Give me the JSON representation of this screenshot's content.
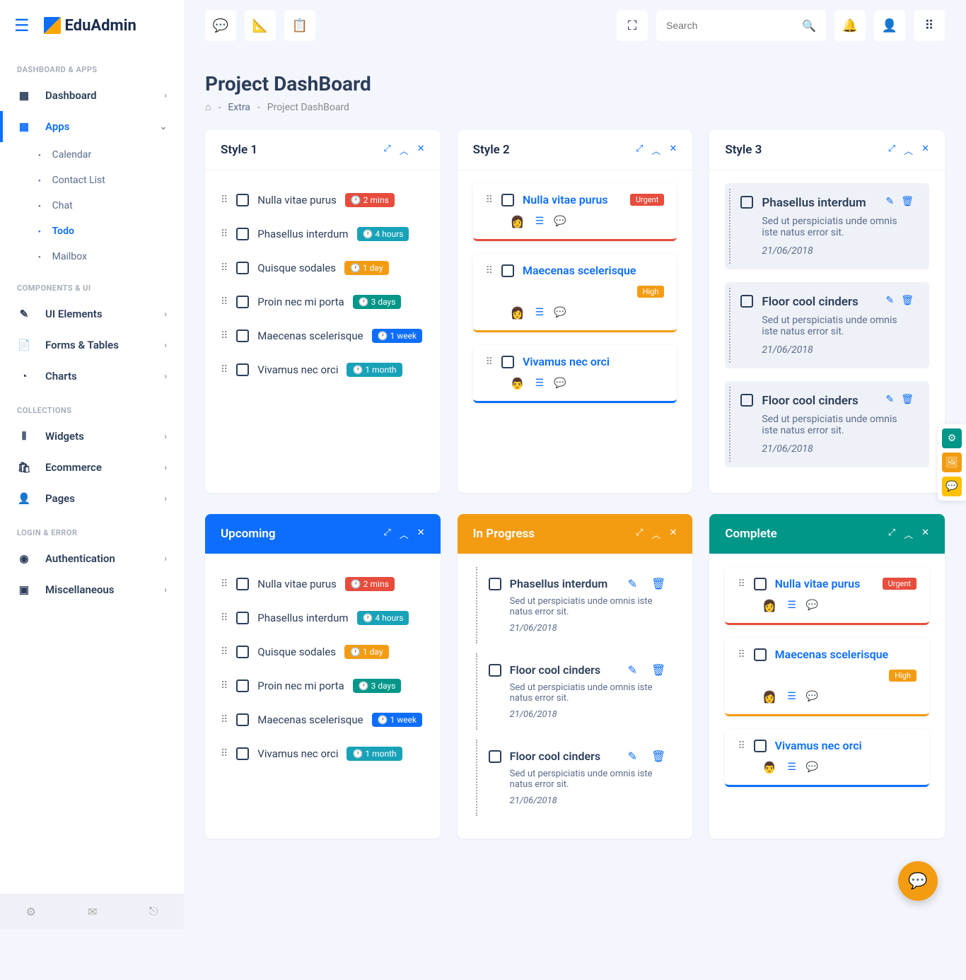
{
  "brand": "EduAdmin",
  "search": {
    "placeholder": "Search"
  },
  "sidebar": {
    "sections": {
      "s0": "DASHBOARD & APPS",
      "s1": "COMPONENTS & UI",
      "s2": "COLLECTIONS",
      "s3": "LOGIN & ERROR"
    },
    "items": {
      "dashboard": "Dashboard",
      "apps": "Apps",
      "ui": "UI Elements",
      "forms": "Forms & Tables",
      "charts": "Charts",
      "widgets": "Widgets",
      "ecommerce": "Ecommerce",
      "pages": "Pages",
      "auth": "Authentication",
      "misc": "Miscellaneous"
    },
    "subs": {
      "calendar": "Calendar",
      "contact": "Contact List",
      "chat": "Chat",
      "todo": "Todo",
      "mailbox": "Mailbox"
    }
  },
  "page": {
    "title": "Project DashBoard",
    "crumb_extra": "Extra",
    "crumb_current": "Project DashBoard"
  },
  "styles": {
    "s1": "Style 1",
    "s2": "Style 2",
    "s3": "Style 3",
    "upcoming": "Upcoming",
    "inProgress": "In Progress",
    "complete": "Complete"
  },
  "tasks1": [
    {
      "text": "Nulla vitae purus",
      "badge": "2 mins",
      "color": "red"
    },
    {
      "text": "Phasellus interdum",
      "badge": "4 hours",
      "color": "cyan"
    },
    {
      "text": "Quisque sodales",
      "badge": "1 day",
      "color": "orange"
    },
    {
      "text": "Proin nec mi porta",
      "badge": "3 days",
      "color": "green"
    },
    {
      "text": "Maecenas scelerisque",
      "badge": "1 week",
      "color": "blue"
    },
    {
      "text": "Vivamus nec orci",
      "badge": "1 month",
      "color": "cyan"
    }
  ],
  "tasks2": [
    {
      "text": "Nulla vitae purus",
      "pill": "Urgent",
      "pcolor": "red",
      "border": "u-red",
      "avatar": "👩"
    },
    {
      "text": "Maecenas scelerisque",
      "pill": "High",
      "pcolor": "orange",
      "border": "u-orange",
      "avatar": "👩"
    },
    {
      "text": "Vivamus nec orci",
      "pill": "",
      "pcolor": "",
      "border": "u-blue",
      "avatar": "👨"
    }
  ],
  "tasks3": [
    {
      "title": "Phasellus interdum",
      "desc": "Sed ut perspiciatis unde omnis iste natus error sit.",
      "date": "21/06/2018"
    },
    {
      "title": "Floor cool cinders",
      "desc": "Sed ut perspiciatis unde omnis iste natus error sit.",
      "date": "21/06/2018"
    },
    {
      "title": "Floor cool cinders",
      "desc": "Sed ut perspiciatis unde omnis iste natus error sit.",
      "date": "21/06/2018"
    }
  ],
  "inProgress": [
    {
      "title": "Phasellus interdum",
      "desc": "Sed ut perspiciatis unde omnis iste natus error sit.",
      "date": "21/06/2018"
    },
    {
      "title": "Floor cool cinders",
      "desc": "Sed ut perspiciatis unde omnis iste natus error sit.",
      "date": "21/06/2018"
    },
    {
      "title": "Floor cool cinders",
      "desc": "Sed ut perspiciatis unde omnis iste natus error sit.",
      "date": "21/06/2018"
    }
  ],
  "complete": [
    {
      "text": "Nulla vitae purus",
      "pill": "Urgent",
      "pcolor": "red",
      "border": "u-red",
      "avatar": "👩"
    },
    {
      "text": "Maecenas scelerisque",
      "pill": "High",
      "pcolor": "orange",
      "border": "u-orange",
      "avatar": "👩"
    },
    {
      "text": "Vivamus nec orci",
      "pill": "",
      "pcolor": "",
      "border": "u-blue",
      "avatar": "👨"
    }
  ]
}
